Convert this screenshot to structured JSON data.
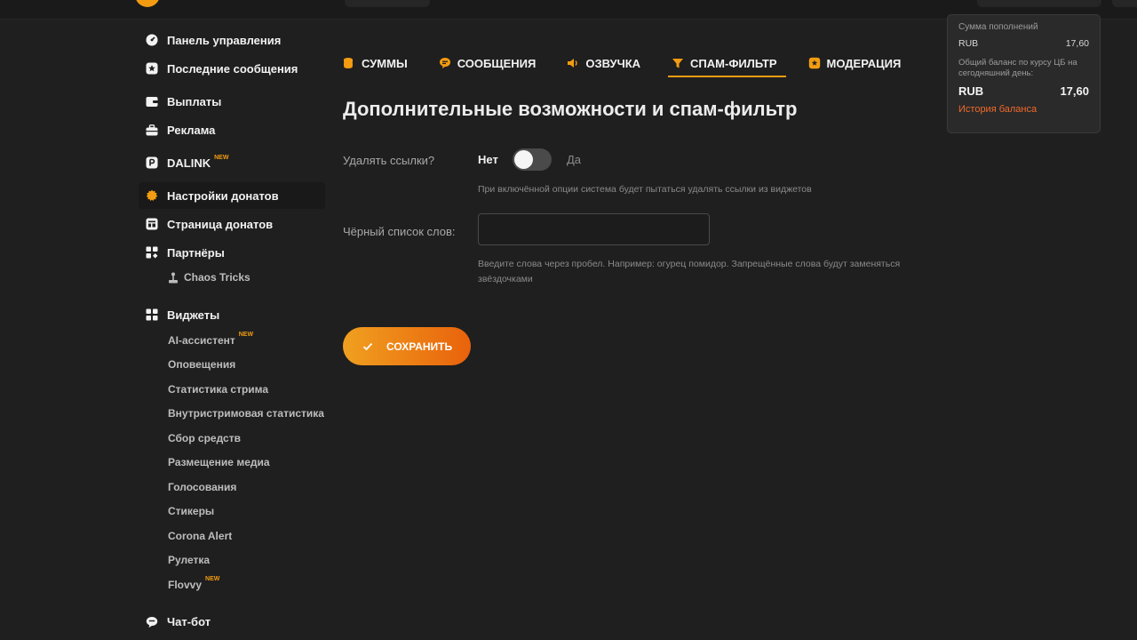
{
  "colors": {
    "accent": "#f39c12",
    "link": "#f0692a",
    "background": "#1f1f1f"
  },
  "sidebar": {
    "items": [
      {
        "label": "Панель управления",
        "icon": "dashboard-icon"
      },
      {
        "label": "Последние сообщения",
        "icon": "star-icon"
      },
      {
        "label": "Выплаты",
        "icon": "wallet-icon"
      },
      {
        "label": "Реклама",
        "icon": "briefcase-icon"
      },
      {
        "label": "DALINK",
        "badge": "NEW",
        "icon": "dalink-icon"
      },
      {
        "label": "Настройки донатов",
        "icon": "gear-icon",
        "active": true
      },
      {
        "label": "Страница донатов",
        "icon": "page-icon"
      },
      {
        "label": "Партнёры",
        "icon": "partners-icon"
      }
    ],
    "partner_sub": {
      "label": "Chaos Tricks",
      "icon": "joystick-icon"
    },
    "widgets": {
      "label": "Виджеты",
      "icon": "widgets-icon",
      "items": [
        {
          "label": "AI-ассистент",
          "badge": "NEW"
        },
        {
          "label": "Оповещения"
        },
        {
          "label": "Статистика стрима"
        },
        {
          "label": "Внутристримовая статистика"
        },
        {
          "label": "Сбор средств"
        },
        {
          "label": "Размещение медиа"
        },
        {
          "label": "Голосования"
        },
        {
          "label": "Стикеры"
        },
        {
          "label": "Corona Alert"
        },
        {
          "label": "Рулетка"
        },
        {
          "label": "Flovvy",
          "badge": "NEW"
        }
      ]
    },
    "chatbot": {
      "label": "Чат-бот",
      "icon": "chat-icon"
    }
  },
  "tabs": [
    {
      "label": "СУММЫ",
      "icon": "coins-icon"
    },
    {
      "label": "СООБЩЕНИЯ",
      "icon": "message-icon"
    },
    {
      "label": "ОЗВУЧКА",
      "icon": "speaker-icon"
    },
    {
      "label": "СПАМ-ФИЛЬТР",
      "icon": "filter-icon",
      "active": true
    },
    {
      "label": "МОДЕРАЦИЯ",
      "icon": "moderation-icon"
    }
  ],
  "page": {
    "title": "Дополнительные возможности и спам-фильтр",
    "delete_links": {
      "label": "Удалять ссылки?",
      "off_label": "Нет",
      "on_label": "Да",
      "enabled": false,
      "hint": "При включённой опции система будет пытаться удалять ссылки из виджетов"
    },
    "blacklist": {
      "label": "Чёрный список слов:",
      "value": "",
      "hint_line1": "Введите слова через пробел. Например: огурец помидор. Запрещённые слова будут заменяться",
      "hint_line2": "звёздочками"
    },
    "save_label": "СОХРАНИТЬ"
  },
  "balance": {
    "title": "Сумма пополнений",
    "currency": "RUB",
    "amount": "17,60",
    "note": "Общий баланс по курсу ЦБ на сегодняшний день:",
    "total_currency": "RUB",
    "total_amount": "17,60",
    "history_link": "История баланса"
  }
}
